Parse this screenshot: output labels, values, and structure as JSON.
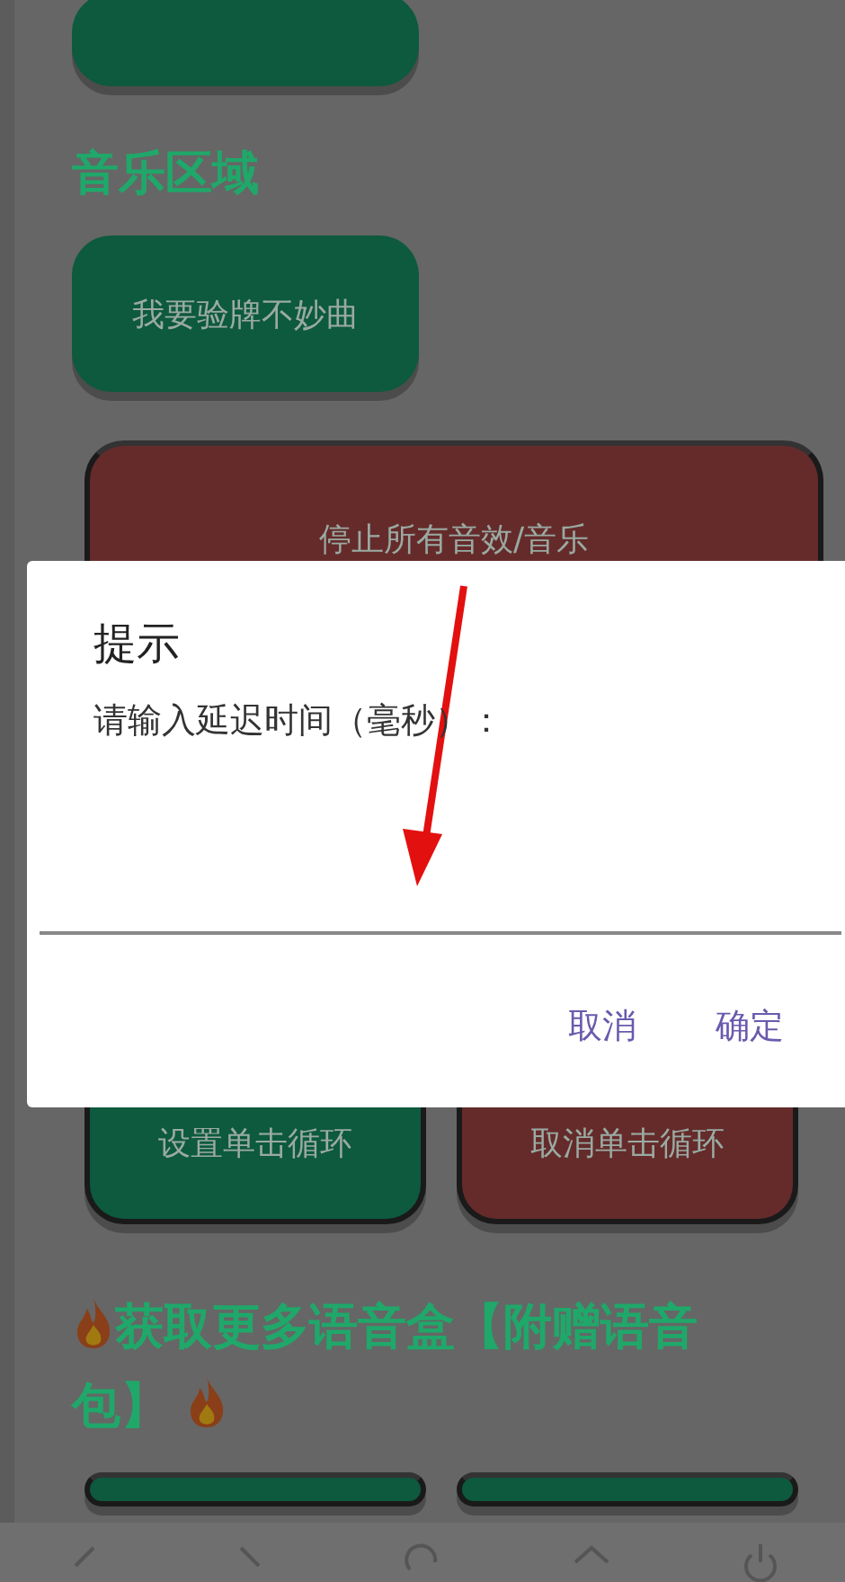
{
  "content": [
    {
      "kind": "stub",
      "buttons": [
        {
          "color": "#0d5a3e"
        }
      ]
    },
    {
      "kind": "heading",
      "text": "音乐区域"
    },
    {
      "kind": "single",
      "buttons": [
        {
          "label": "我要验牌不妙曲",
          "color": "#0d5a3e"
        }
      ]
    },
    {
      "kind": "wide",
      "buttons": [
        {
          "label": "停止所有音效/音乐",
          "color": "#652b2b"
        }
      ]
    },
    {
      "kind": "pair",
      "buttons": [
        {
          "label": "设置单击循环",
          "color": "#0d5a3e"
        },
        {
          "label": "取消单击循环",
          "color": "#652b2b"
        }
      ]
    },
    {
      "kind": "flame_heading",
      "text": "获取更多语音盒【附赠语音包】"
    },
    {
      "kind": "pair_cut",
      "buttons": [
        {
          "color": "#0d5a3e"
        },
        {
          "color": "#0d5a3e"
        }
      ]
    }
  ],
  "dialog": {
    "title": "提示",
    "message": "请输入延迟时间（毫秒）：",
    "buttons": [
      "取消",
      "确定"
    ]
  }
}
